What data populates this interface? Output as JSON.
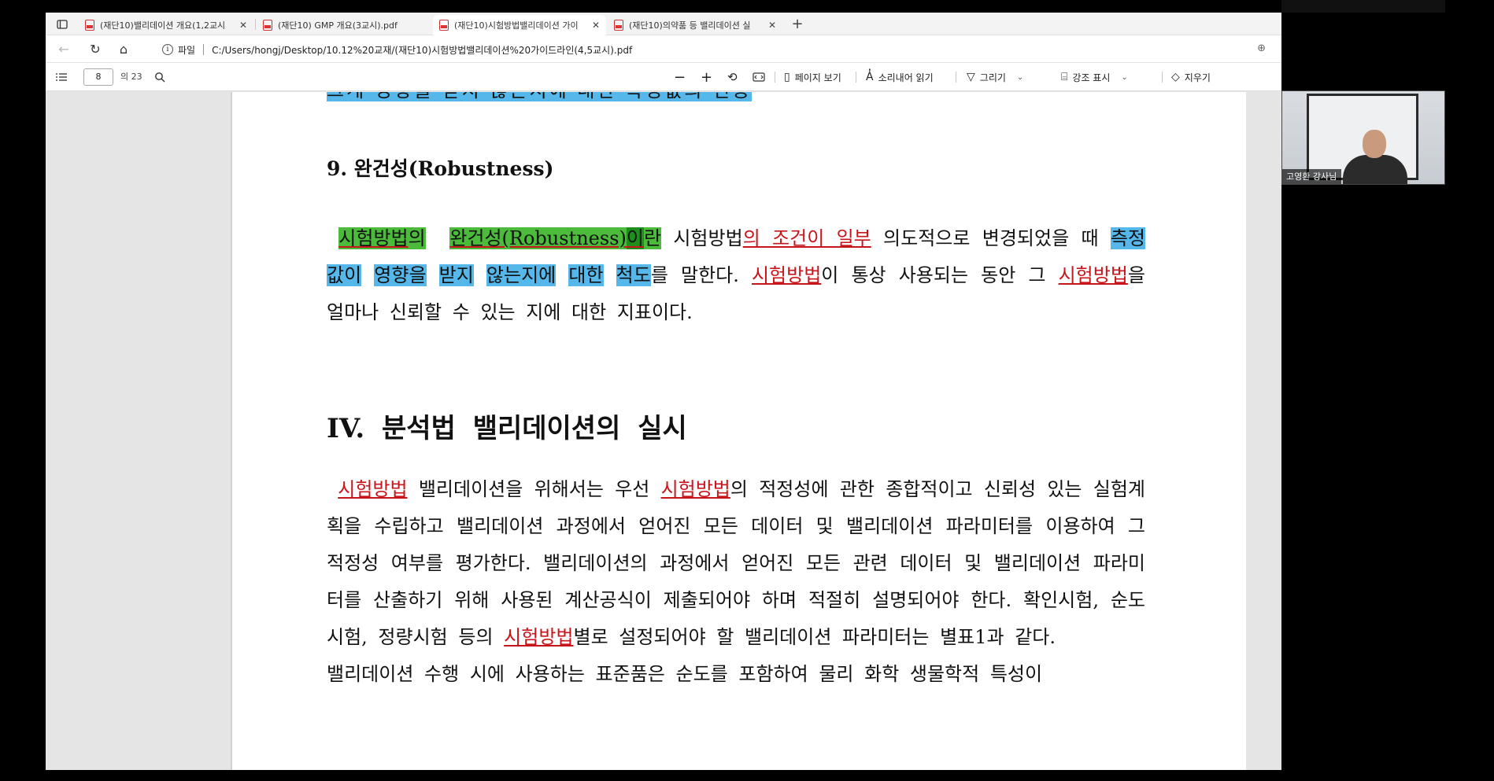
{
  "browser": {
    "tabs": [
      {
        "title": "(재단10)밸리데이션 개요(1,2교시",
        "active": false
      },
      {
        "title": "(재단10) GMP 개요(3교시).pdf",
        "active": false
      },
      {
        "title": "(재단10)시험방법밸리데이션 가이",
        "active": true
      },
      {
        "title": "(재단10)의약품 등 밸리데이션 실",
        "active": false
      }
    ],
    "address": {
      "file_label": "파일",
      "url": "C:/Users/hongj/Desktop/10.12%20교재/(재단10)시험방법밸리데이션%20가이드라인(4,5교시).pdf"
    }
  },
  "pdf_toolbar": {
    "page_number": "8",
    "page_total": "의 23",
    "page_view_label": "페이지 보기",
    "read_aloud_label": "소리내어 읽기",
    "draw_label": "그리기",
    "highlight_label": "강조 표시",
    "erase_label": "지우기"
  },
  "document": {
    "cut_line": "크게 영향을 받지 않는지에 대한 측정값의 변동",
    "heading_9": "9. 완건성(Robustness)",
    "p1": {
      "s1": "시험방법",
      "s2": "의",
      "s3": "완건성(Robustness)",
      "s4": "이",
      "s5": "란",
      "s6": " 시험방법",
      "s7": "의 조건이 일부",
      "s8": " 의도적으로 변경되었을 때 ",
      "s9": "측정값이",
      "s10": " ",
      "s11": "영향을",
      "s12": " ",
      "s13": "받지",
      "s14": " ",
      "s15": "않는지에",
      "s16": " ",
      "s17": "대한",
      "s18": " ",
      "s19": "척도",
      "s20": "를 말한다. ",
      "s21": "시험방법",
      "s22": "이 통상 사용되는 동안 그 ",
      "s23": "시험방법",
      "s24": "을 얼마나 신뢰할 수 있는 지에 대한 지표이다."
    },
    "heading_iv": "IV.  분석법 밸리데이션의 실시",
    "p2": {
      "s1": "시험방법",
      "s2": " 밸리데이션을 위해서는 우선 ",
      "s3": "시험방법",
      "s4": "의 적정성에 관한 종합적이고 신뢰성 있는 실험계획을 수립하고 밸리데이션 과정에서 얻어진 모든 데이터 및 밸리데이션 파라미터를 이용하여 그 적정성 여부를 평가한다. 밸리데이션의 과정에서 얻어진 모든 관련 데이터 및 밸리데이션  파라미터를 산출하기 위해 사용된 계산공식이 제출되어야 하며 적절히 설명되어야 한다. 확인시험, 순도시험, 정량시험 등의 ",
      "s5": "시험방법",
      "s6": "별로 설정되어야 할 밸리데이션 파라미터는 별표1과 같다.",
      "s7": "밸리데이션 수행 시에 사용하는 표준품은 순도를 포함하여 물리 화학 생물학적 특성이"
    }
  },
  "webcam": {
    "name": "고영환 강사님"
  }
}
